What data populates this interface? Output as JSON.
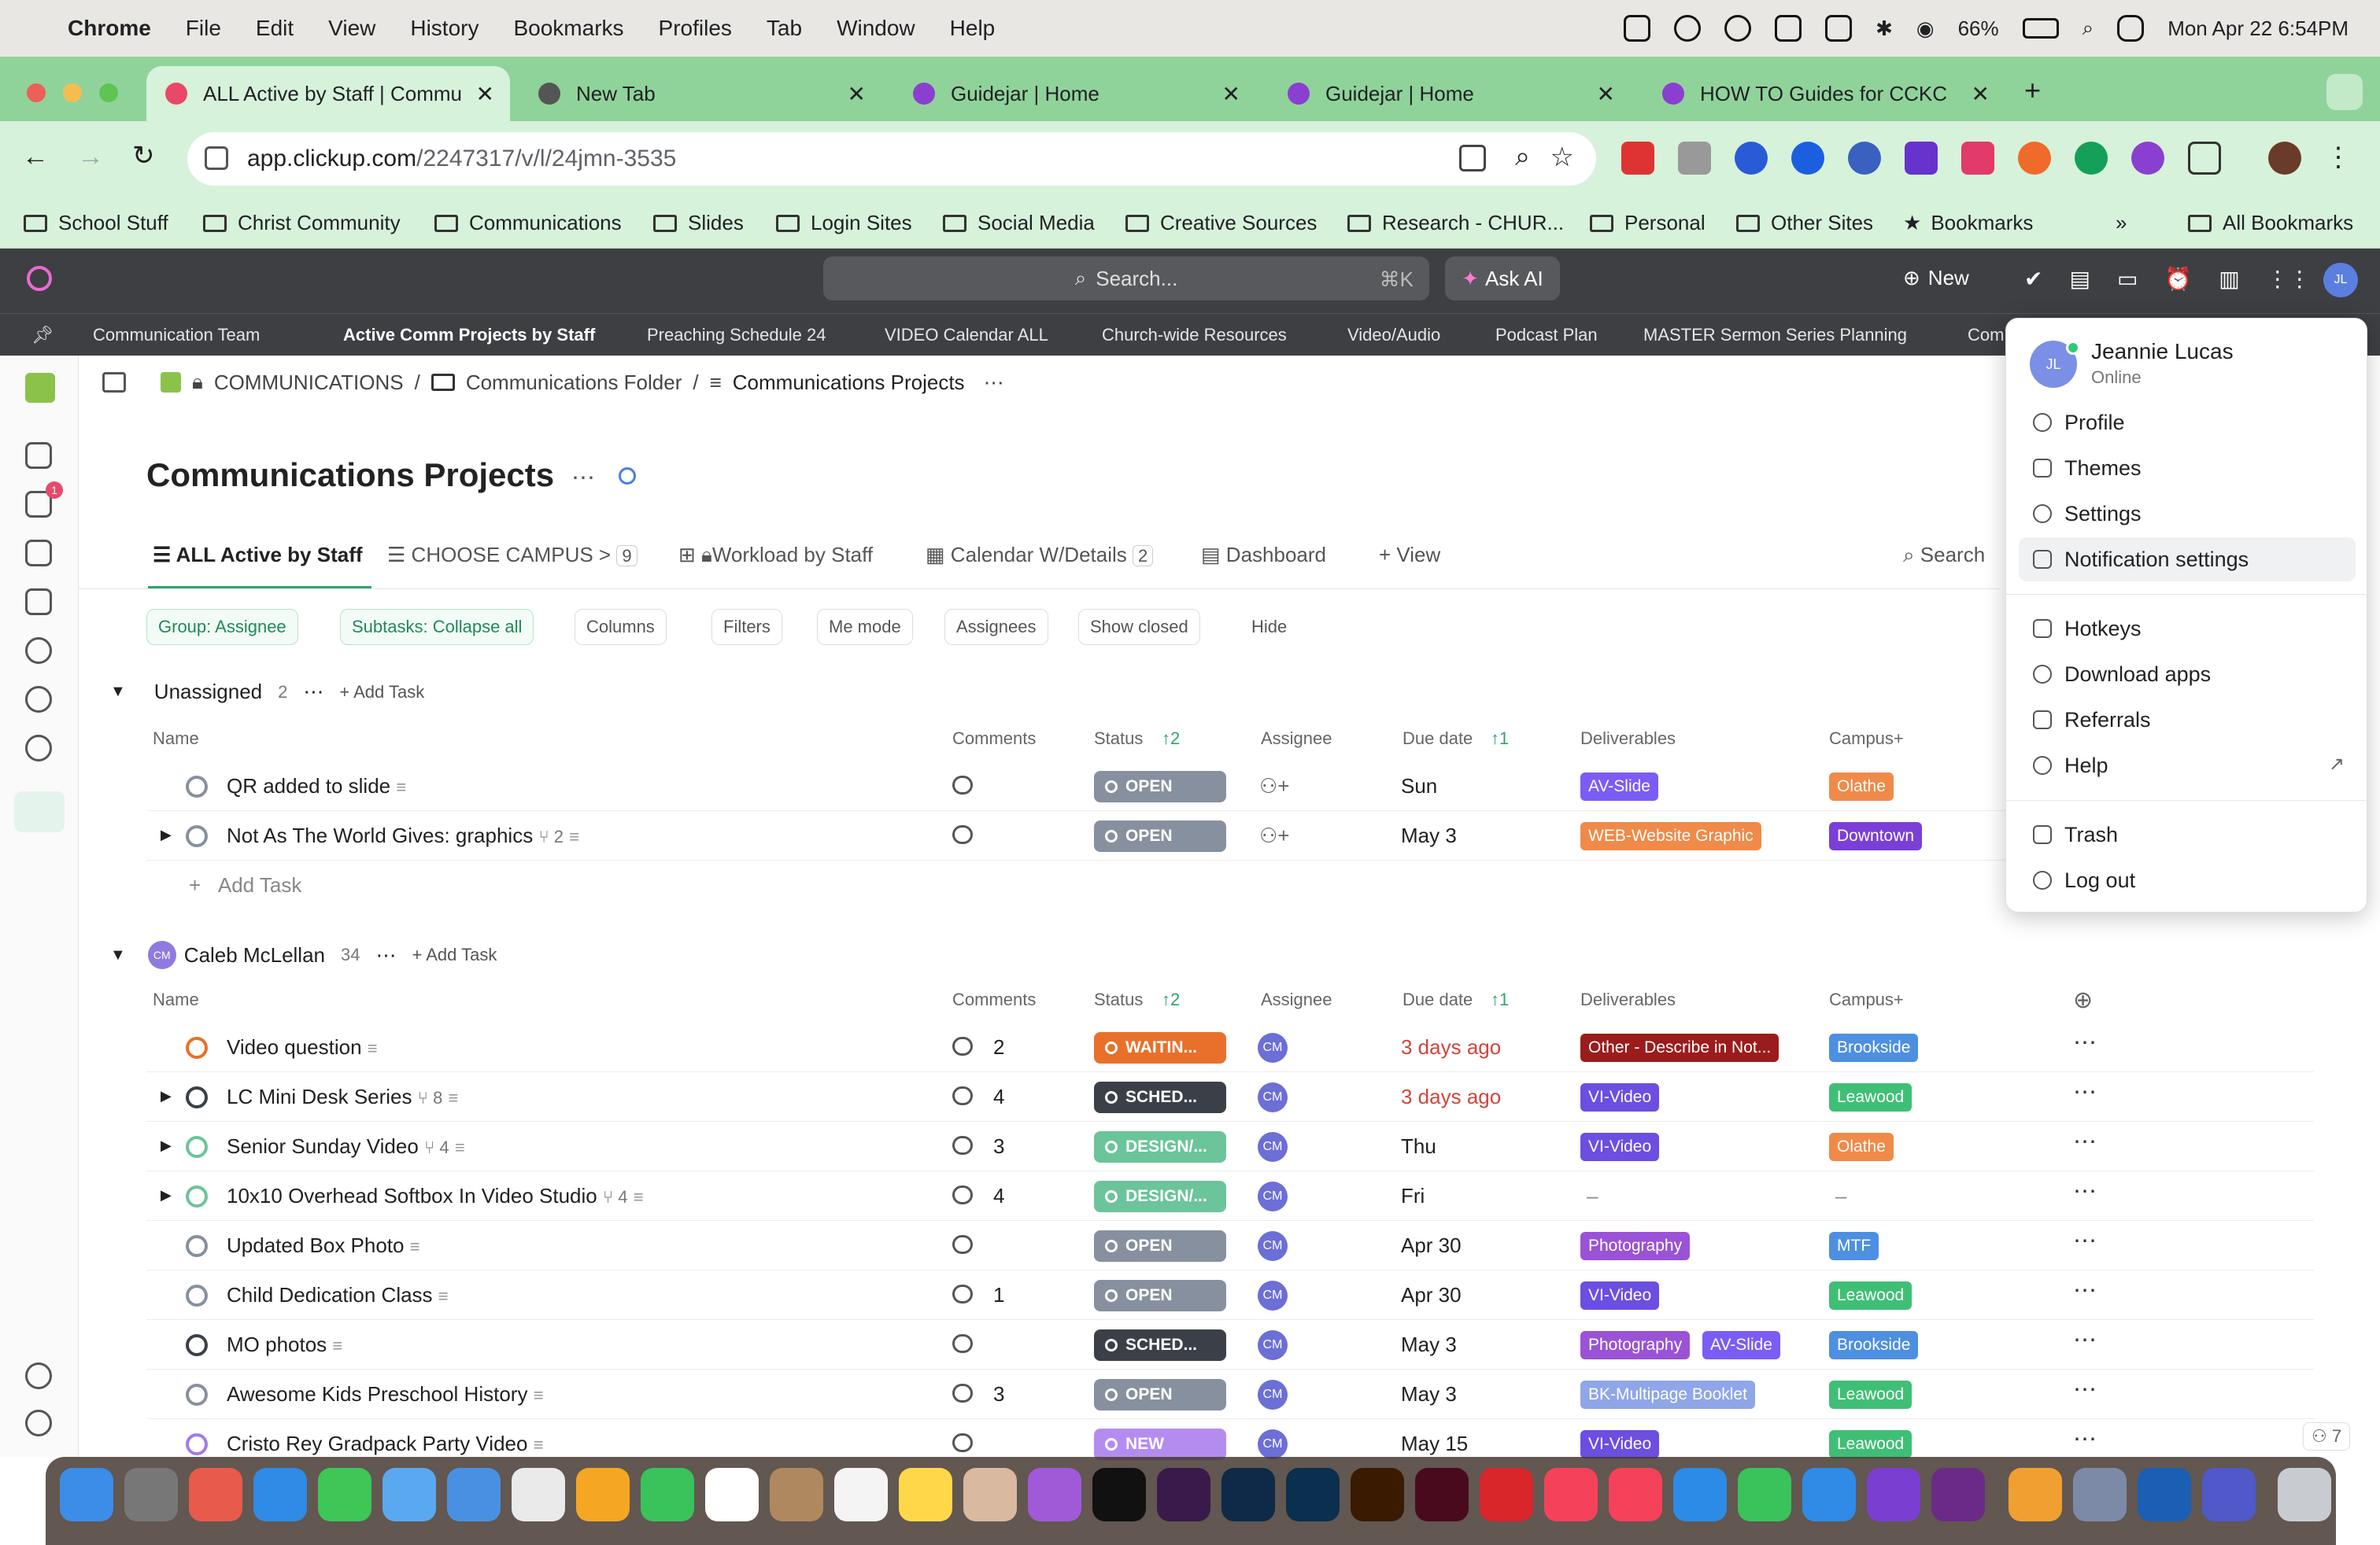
{
  "menubar": {
    "app": "Chrome",
    "items": [
      "File",
      "Edit",
      "View",
      "History",
      "Bookmarks",
      "Profiles",
      "Tab",
      "Window",
      "Help"
    ],
    "battery": "66%",
    "datetime": "Mon Apr 22  6:54PM"
  },
  "tabs": [
    {
      "title": "ALL Active by Staff | Commu",
      "active": true
    },
    {
      "title": "New Tab"
    },
    {
      "title": "Guidejar | Home"
    },
    {
      "title": "Guidejar | Home"
    },
    {
      "title": "HOW TO Guides for CCKC"
    }
  ],
  "url": {
    "host": "app.clickup.com",
    "path": "/2247317/v/l/24jmn-3535"
  },
  "bookmarks": [
    "School Stuff",
    "Christ Community",
    "Communications",
    "Slides",
    "Login Sites",
    "Social Media",
    "Creative Sources",
    "Research - CHUR...",
    "Personal",
    "Other Sites",
    "Bookmarks",
    "All Bookmarks"
  ],
  "cu_top": {
    "search": "Search...",
    "shortcut": "⌘K",
    "ask_ai": "Ask AI",
    "new": "New"
  },
  "favorites": [
    "Communication Team",
    "Active Comm Projects by Staff",
    "Preaching Schedule 24",
    "VIDEO Calendar ALL",
    "Church-wide Resources",
    "Video/Audio",
    "Podcast Plan",
    "MASTER Sermon Series Planning",
    "Com"
  ],
  "breadcrumb": [
    "COMMUNICATIONS",
    "Communications Folder",
    "Communications Projects"
  ],
  "page_title": "Communications Projects",
  "views": [
    {
      "label": "ALL Active by Staff"
    },
    {
      "label": "CHOOSE CAMPUS >",
      "badge": "9"
    },
    {
      "label": "Workload by Staff"
    },
    {
      "label": "Calendar W/Details",
      "badge": "2"
    },
    {
      "label": "Dashboard"
    },
    {
      "label": "+ View"
    }
  ],
  "search_label": "Search",
  "chips": [
    "Group: Assignee",
    "Subtasks: Collapse all",
    "Columns",
    "Filters",
    "Me mode",
    "Assignees",
    "Show closed",
    "Hide"
  ],
  "columns": {
    "name": "Name",
    "comments": "Comments",
    "status": "Status",
    "status_sort": "2",
    "assignee": "Assignee",
    "due": "Due date",
    "due_sort": "1",
    "deliverables": "Deliverables",
    "campus": "Campus+"
  },
  "group1": {
    "name": "Unassigned",
    "count": "2",
    "add": "Add Task",
    "rows": [
      {
        "name": "QR added to slide",
        "comments": "",
        "status": "OPEN",
        "status_color": "#87909e",
        "due": "Sun",
        "deliverables": [
          {
            "t": "AV-Slide",
            "c": "#7b5cf5"
          }
        ],
        "campus": [
          {
            "t": "Olathe",
            "c": "#f08a48"
          }
        ]
      },
      {
        "name": "Not As The World Gives: graphics",
        "sub": "2",
        "comments": "",
        "status": "OPEN",
        "status_color": "#87909e",
        "due": "May 3",
        "deliverables": [
          {
            "t": "WEB-Website Graphic",
            "c": "#f08a48"
          }
        ],
        "campus": [
          {
            "t": "Downtown",
            "c": "#7b3fd8"
          }
        ]
      }
    ]
  },
  "add_task": "Add Task",
  "group2": {
    "name": "Caleb McLellan",
    "count": "34",
    "add": "Add Task",
    "initials": "CM",
    "rows": [
      {
        "name": "Video question",
        "comments": "2",
        "status": "WAITIN...",
        "status_color": "#e8702a",
        "due": "3 days ago",
        "overdue": true,
        "deliverables": [
          {
            "t": "Other - Describe in Not...",
            "c": "#9b1c1c"
          }
        ],
        "campus": [
          {
            "t": "Brookside",
            "c": "#4d8fe0"
          }
        ],
        "dot": "#e8702a"
      },
      {
        "name": "LC Mini Desk Series",
        "sub": "8",
        "comments": "4",
        "status": "SCHED...",
        "status_color": "#3b4048",
        "due": "3 days ago",
        "overdue": true,
        "deliverables": [
          {
            "t": "VI-Video",
            "c": "#6c4ee0"
          }
        ],
        "campus": [
          {
            "t": "Leawood",
            "c": "#3fbf75"
          }
        ],
        "dot": "#3b4048"
      },
      {
        "name": "Senior Sunday Video",
        "sub": "4",
        "comments": "3",
        "status": "DESIGN/...",
        "status_color": "#6cc49a",
        "due": "Thu",
        "deliverables": [
          {
            "t": "VI-Video",
            "c": "#6c4ee0"
          }
        ],
        "campus": [
          {
            "t": "Olathe",
            "c": "#f08a48"
          }
        ],
        "dot": "#6cc49a"
      },
      {
        "name": "10x10 Overhead Softbox In Video Studio",
        "sub": "4",
        "comments": "4",
        "status": "DESIGN/...",
        "status_color": "#6cc49a",
        "due": "Fri",
        "deliverables": [
          {
            "t": "–",
            "c": ""
          }
        ],
        "campus": [
          {
            "t": "–",
            "c": ""
          }
        ],
        "dot": "#6cc49a"
      },
      {
        "name": "Updated Box Photo",
        "comments": "",
        "status": "OPEN",
        "status_color": "#87909e",
        "due": "Apr 30",
        "deliverables": [
          {
            "t": "Photography",
            "c": "#9a52d6"
          }
        ],
        "campus": [
          {
            "t": "MTF",
            "c": "#4d8fe0"
          }
        ],
        "dot": "#87909e"
      },
      {
        "name": "Child Dedication Class",
        "comments": "1",
        "status": "OPEN",
        "status_color": "#87909e",
        "due": "Apr 30",
        "deliverables": [
          {
            "t": "VI-Video",
            "c": "#6c4ee0"
          }
        ],
        "campus": [
          {
            "t": "Leawood",
            "c": "#3fbf75"
          }
        ],
        "dot": "#87909e"
      },
      {
        "name": "MO photos",
        "comments": "",
        "status": "SCHED...",
        "status_color": "#3b4048",
        "due": "May 3",
        "deliverables": [
          {
            "t": "Photography",
            "c": "#9a52d6"
          },
          {
            "t": "AV-Slide",
            "c": "#7b5cf5"
          }
        ],
        "campus": [
          {
            "t": "Brookside",
            "c": "#4d8fe0"
          }
        ],
        "dot": "#3b4048"
      },
      {
        "name": "Awesome Kids Preschool History",
        "comments": "3",
        "status": "OPEN",
        "status_color": "#87909e",
        "due": "May 3",
        "deliverables": [
          {
            "t": "BK-Multipage Booklet",
            "c": "#8fa6e8"
          }
        ],
        "campus": [
          {
            "t": "Leawood",
            "c": "#3fbf75"
          }
        ],
        "dot": "#87909e"
      },
      {
        "name": "Cristo Rey Gradpack Party Video",
        "comments": "",
        "status": "NEW",
        "status_color": "#b48cf0",
        "due": "May 15",
        "deliverables": [
          {
            "t": "VI-Video",
            "c": "#6c4ee0"
          }
        ],
        "campus": [
          {
            "t": "Leawood",
            "c": "#3fbf75"
          }
        ],
        "dot": "#a27be8"
      }
    ]
  },
  "user_menu": {
    "name": "Jeannie Lucas",
    "status": "Online",
    "initials": "JL",
    "items": [
      "Profile",
      "Themes",
      "Settings",
      "Notification settings",
      "Hotkeys",
      "Download apps",
      "Referrals",
      "Help",
      "Trash",
      "Log out"
    ]
  },
  "watchers": "7",
  "inbox_badge": "1"
}
